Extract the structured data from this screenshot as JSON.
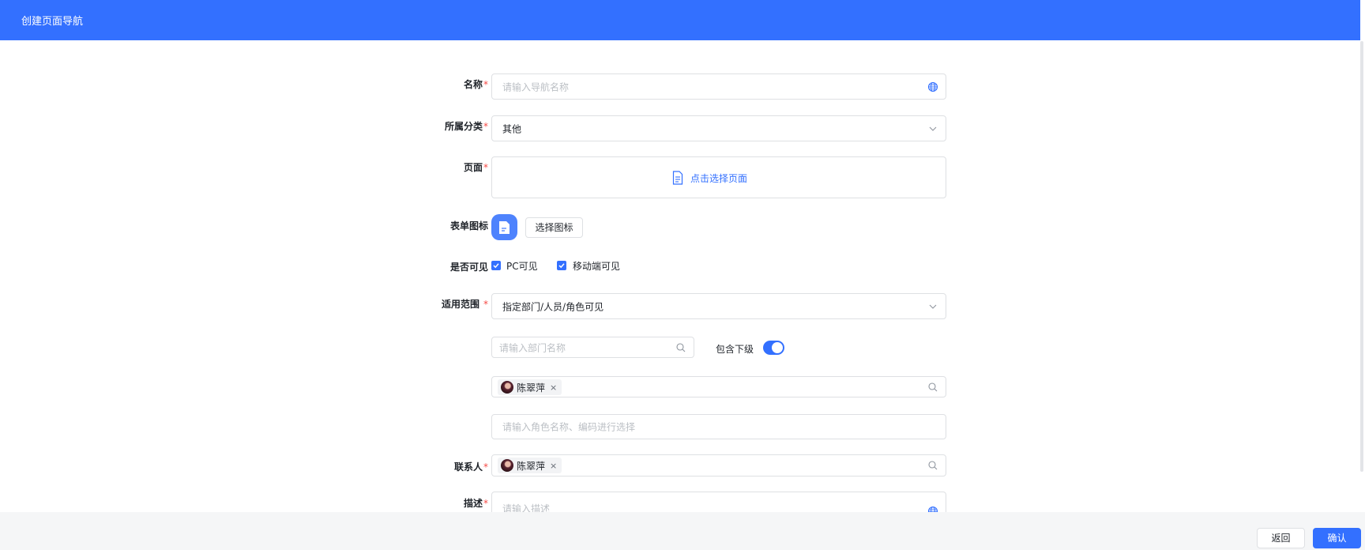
{
  "header": {
    "title": "创建页面导航"
  },
  "form": {
    "name": {
      "label": "名称",
      "required": "*",
      "placeholder": "请输入导航名称",
      "icon": "globe-icon"
    },
    "category": {
      "label": "所属分类",
      "required": "*",
      "value": "其他",
      "icon": "chevron-down-icon"
    },
    "page": {
      "label": "页面",
      "required": "*",
      "link_text": "点击选择页面",
      "icon": "document-icon"
    },
    "form_icon": {
      "label": "表单图标",
      "button_label": "选择图标",
      "icon": "form-document-icon"
    },
    "visibility": {
      "label": "是否可见",
      "options": [
        {
          "label": "PC可见",
          "checked": true
        },
        {
          "label": "移动端可见",
          "checked": true
        }
      ]
    },
    "scope": {
      "label": "适用范围",
      "required": "*",
      "value": "指定部门/人员/角色可见",
      "department_placeholder": "请输入部门名称",
      "include_sub_label": "包含下级",
      "include_sub_on": true,
      "member_tag": "陈翠萍",
      "role_placeholder": "请输入角色名称、编码进行选择"
    },
    "contact": {
      "label": "联系人",
      "required": "*",
      "tag": "陈翠萍"
    },
    "description": {
      "label": "描述",
      "required": "*",
      "placeholder": "请输入描述",
      "icon": "globe-icon"
    }
  },
  "footer": {
    "back_label": "返回",
    "confirm_label": "确认"
  },
  "colors": {
    "primary": "#3370ff",
    "required": "#f54a45",
    "border": "#dee0e3",
    "footer_bg": "#f5f6f7"
  }
}
